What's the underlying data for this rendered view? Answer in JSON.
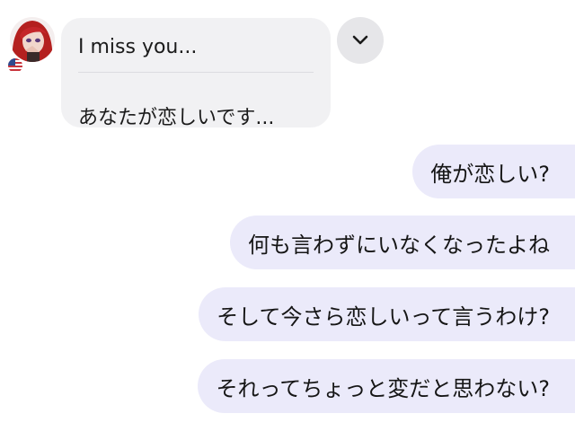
{
  "incoming_message": {
    "original": "I miss you...",
    "translation": "あなたが恋しいです..."
  },
  "outgoing_messages": [
    {
      "text": "俺が恋しい?"
    },
    {
      "text": "何も言わずにいなくなったよね"
    },
    {
      "text": "そして今さら恋しいって言うわけ?"
    },
    {
      "text": "それってちょっと変だと思わない?"
    }
  ],
  "icons": {
    "avatar": "avatar-red-hair",
    "flag": "us-flag-icon",
    "dropdown": "chevron-down-icon"
  },
  "colors": {
    "incoming_bubble": "#f1f1f3",
    "outgoing_bubble": "#ebeafa",
    "dropdown_bg": "#e6e6e9"
  }
}
